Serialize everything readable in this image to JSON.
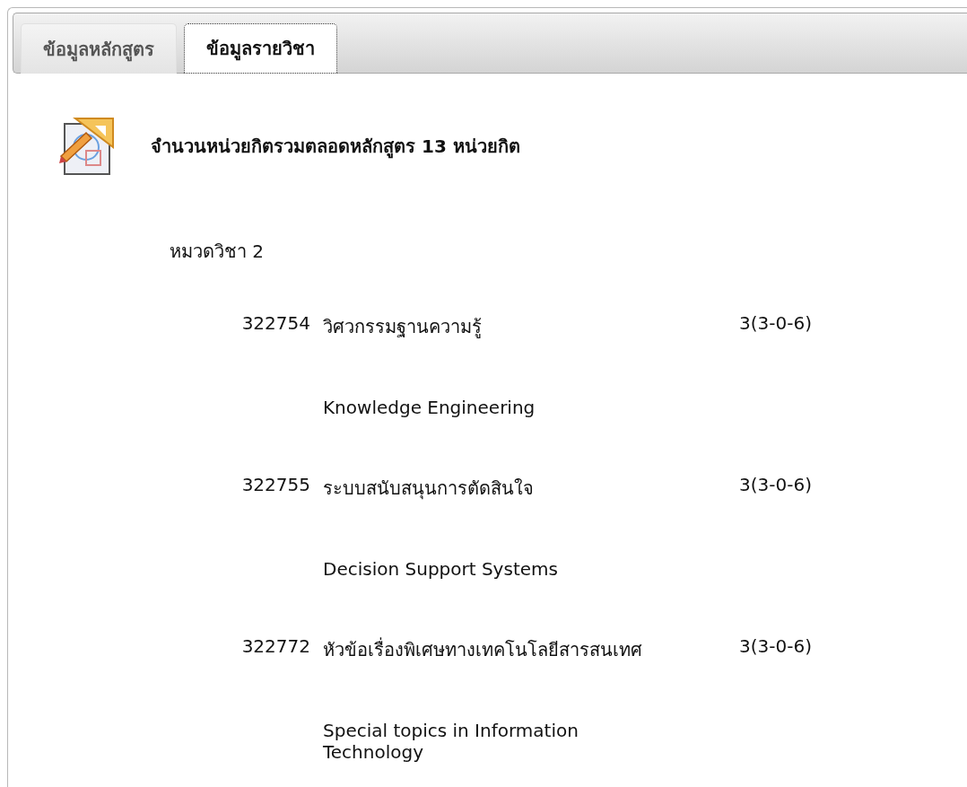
{
  "tabs": [
    {
      "label": "ข้อมูลหลักสูตร",
      "selected": false
    },
    {
      "label": "ข้อมูลรายวิชา",
      "selected": true
    }
  ],
  "summary": "จำนวนหน่วยกิตรวมตลอดหลักสูตร 13 หน่วยกิต",
  "category": "หมวดวิชา 2",
  "courses": [
    {
      "code": "322754",
      "name_th": "วิศวกรรมฐานความรู้",
      "credits": "3(3-0-6)",
      "name_en": "Knowledge Engineering"
    },
    {
      "code": "322755",
      "name_th": "ระบบสนับสนุนการตัดสินใจ",
      "credits": "3(3-0-6)",
      "name_en": "Decision Support Systems"
    },
    {
      "code": "322772",
      "name_th": "หัวข้อเรื่องพิเศษทางเทคโนโลยีสารสนเทศ",
      "credits": "3(3-0-6)",
      "name_en": "Special topics in Information Technology"
    }
  ]
}
